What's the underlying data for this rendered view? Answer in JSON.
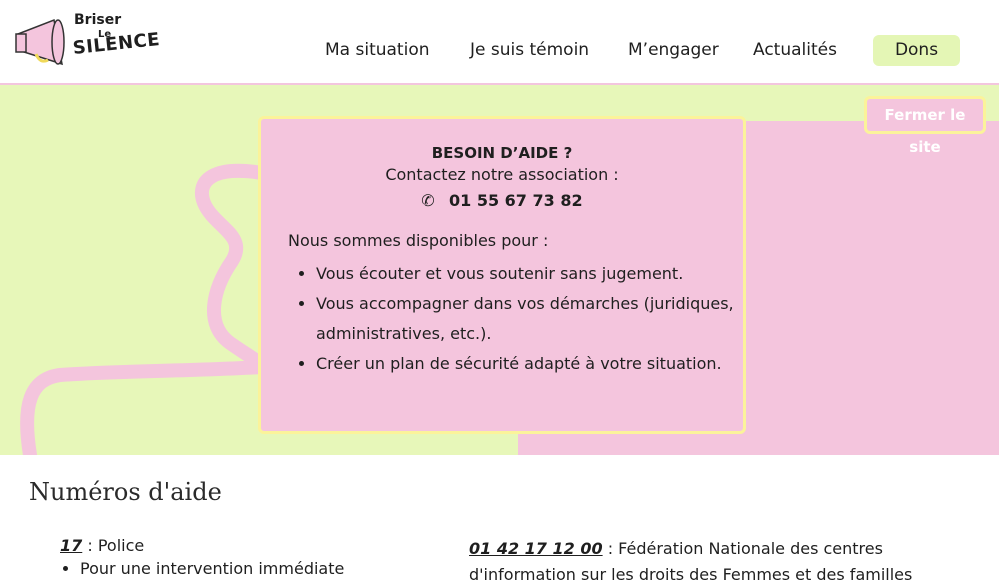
{
  "header": {
    "logo": {
      "line1": "Briser",
      "line2": "Le",
      "line3": "SILENCE"
    },
    "nav": [
      {
        "label": "Ma situation"
      },
      {
        "label": "Je suis témoin"
      },
      {
        "label": "M’engager"
      },
      {
        "label": "Actualités"
      }
    ],
    "donate_label": "Dons"
  },
  "hero": {
    "close_site_label": "Fermer le site",
    "card": {
      "title": "BESOIN D’AIDE ?",
      "subtitle": "Contactez notre association :",
      "phone": "01 55 67 73 82",
      "intro": "Nous sommes disponibles pour :",
      "items": [
        "Vous écouter et vous soutenir sans jugement.",
        "Vous accompagner dans vos démarches (juridiques, administratives, etc.).",
        "Créer un plan de sécurité adapté à votre situation."
      ]
    }
  },
  "help_numbers": {
    "heading": "Numéros d'aide",
    "left": {
      "number": "17",
      "text": " : Police",
      "bullets": [
        "Pour une intervention immédiate"
      ]
    },
    "right": {
      "number": "01 42 17 12 00",
      "text": " : Fédération Nationale des centres d'information sur les droits des Femmes et des familles"
    }
  },
  "colors": {
    "green": "#e7f7b9",
    "pink": "#f4c5dd",
    "yellow": "#fbf39a",
    "lime_button": "#e4f6b5"
  }
}
